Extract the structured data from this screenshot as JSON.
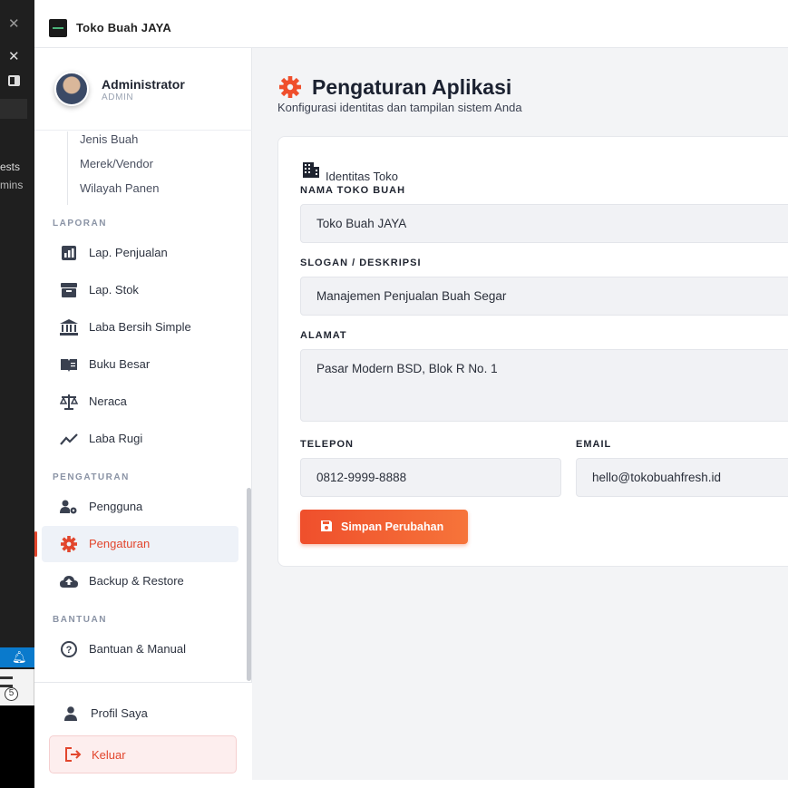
{
  "editor_strip": {
    "line1": "ests",
    "line2": "mins",
    "badge_count": "5"
  },
  "topbar": {
    "app_title": "Toko Buah JAYA"
  },
  "profile": {
    "name": "Administrator",
    "role": "ADMIN"
  },
  "submenu": [
    "Jenis Buah",
    "Merek/Vendor",
    "Wilayah Panen"
  ],
  "sections": {
    "laporan": "LAPORAN",
    "pengaturan": "PENGATURAN",
    "bantuan": "BANTUAN"
  },
  "laporan_items": [
    {
      "label": "Lap. Penjualan",
      "icon": "bar-chart-icon"
    },
    {
      "label": "Lap. Stok",
      "icon": "archive-icon"
    },
    {
      "label": "Laba Bersih Simple",
      "icon": "bank-icon"
    },
    {
      "label": "Buku Besar",
      "icon": "book-icon"
    },
    {
      "label": "Neraca",
      "icon": "scale-icon"
    },
    {
      "label": "Laba Rugi",
      "icon": "trend-line-icon"
    }
  ],
  "pengaturan_items": [
    {
      "label": "Pengguna",
      "icon": "users-gear-icon"
    },
    {
      "label": "Pengaturan",
      "icon": "gear-icon"
    },
    {
      "label": "Backup & Restore",
      "icon": "cloud-upload-icon"
    }
  ],
  "bantuan_items": [
    {
      "label": "Bantuan & Manual",
      "icon": "question-circle-icon"
    }
  ],
  "footer": {
    "profile": "Profil Saya",
    "logout": "Keluar"
  },
  "page": {
    "title": "Pengaturan Aplikasi",
    "subtitle": "Konfigurasi identitas dan tampilan sistem Anda",
    "section_title": "Identitas Toko"
  },
  "form": {
    "nama_label": "NAMA TOKO BUAH",
    "nama_value": "Toko Buah JAYA",
    "slogan_label": "SLOGAN / DESKRIPSI",
    "slogan_value": "Manajemen Penjualan Buah Segar",
    "alamat_label": "ALAMAT",
    "alamat_value": "Pasar Modern BSD, Blok R No. 1",
    "telepon_label": "TELEPON",
    "telepon_value": "0812-9999-8888",
    "email_label": "EMAIL",
    "email_value": "hello@tokobuahfresh.id",
    "save_label": "Simpan Perubahan"
  },
  "colors": {
    "accent": "#e2462d",
    "active_bg": "#eef2f8",
    "main_bg": "#f3f4f6"
  }
}
